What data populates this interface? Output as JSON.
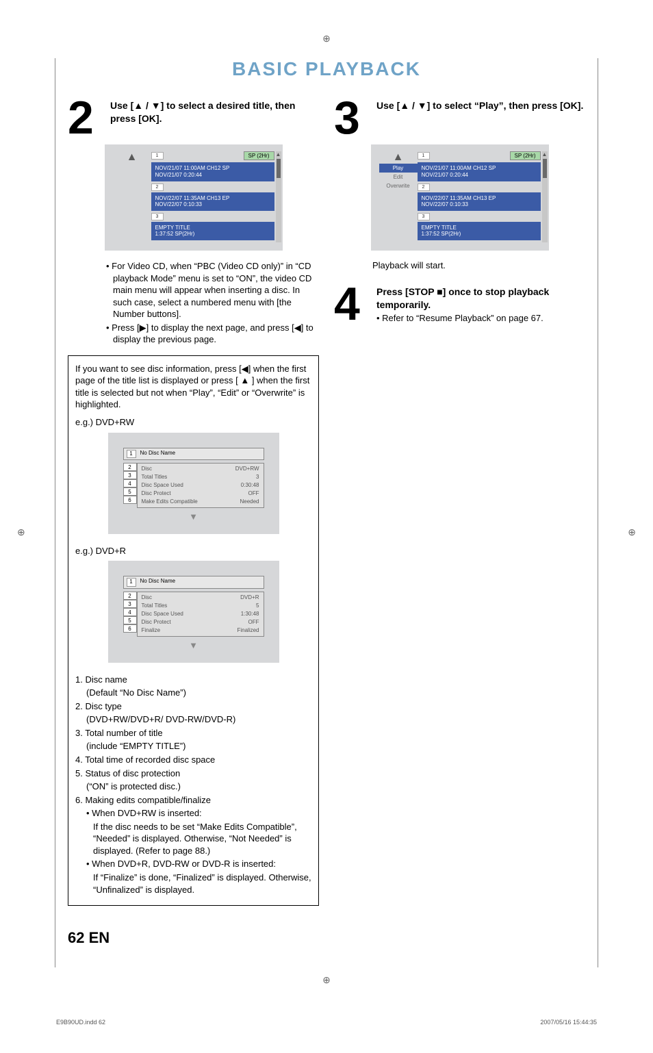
{
  "section_title": "BASIC PLAYBACK",
  "step2": {
    "head": "Use [▲ / ▼] to select a desired title, then press [OK].",
    "panel": {
      "sp_badge": "1",
      "sp_right": "SP (2Hr)",
      "rows": [
        {
          "line1": "NOV/21/07  11:00AM CH12  SP",
          "line2": "NOV/21/07    0:20:44"
        },
        {
          "line1": "NOV/22/07  11:35AM CH13  EP",
          "line2": "NOV/22/07    0:10:33"
        },
        {
          "line1": "EMPTY TITLE",
          "line2": "1:37:52   SP(2Hr)"
        }
      ],
      "row_badges": [
        "2",
        "3"
      ]
    },
    "bullets": [
      "• For Video CD, when “PBC (Video CD only)” in “CD playback Mode” menu is set to “ON”, the video CD main menu will appear when inserting a disc. In such case, select a numbered menu with [the Number buttons].",
      "• Press [▶] to display the next page, and press [◀] to display the previous page."
    ]
  },
  "infobox": {
    "intro": "If you want to see disc information, press [◀] when the first page of the title list is displayed or press [ ▲ ] when the first title is selected but not when “Play”, “Edit” or “Overwrite” is highlighted.",
    "eg1_label": "e.g.) DVD+RW",
    "eg2_label": "e.g.) DVD+R",
    "disc1": {
      "name_num": "1",
      "name": "No Disc Name",
      "rows": [
        {
          "n": "2",
          "k": "Disc",
          "v": "DVD+RW"
        },
        {
          "n": "3",
          "k": "Total Titles",
          "v": "3"
        },
        {
          "n": "4",
          "k": "Disc Space Used",
          "v": "0:30:48"
        },
        {
          "n": "5",
          "k": "Disc Protect",
          "v": "OFF"
        },
        {
          "n": "6",
          "k": "Make Edits Compatible",
          "v": "Needed"
        }
      ]
    },
    "disc2": {
      "name_num": "1",
      "name": "No Disc Name",
      "rows": [
        {
          "n": "2",
          "k": "Disc",
          "v": "DVD+R"
        },
        {
          "n": "3",
          "k": "Total Titles",
          "v": "5"
        },
        {
          "n": "4",
          "k": "Disc Space Used",
          "v": "1:30:48"
        },
        {
          "n": "5",
          "k": "Disc Protect",
          "v": "OFF"
        },
        {
          "n": "6",
          "k": "Finalize",
          "v": "Finalized"
        }
      ]
    },
    "list": {
      "i1a": "1. Disc name",
      "i1b": "(Default “No Disc Name”)",
      "i2a": "2. Disc type",
      "i2b": "(DVD+RW/DVD+R/ DVD-RW/DVD-R)",
      "i3a": "3. Total number of title",
      "i3b": "(include “EMPTY TITLE”)",
      "i4": "4. Total time of recorded disc space",
      "i5a": "5. Status of disc protection",
      "i5b": "(“ON” is protected disc.)",
      "i6": "6. Making edits compatible/finalize",
      "i6a": "• When DVD+RW is inserted:",
      "i6a2": "If the disc needs to be set “Make Edits Compatible”, “Needed” is displayed. Otherwise, “Not Needed” is displayed. (Refer to page 88.)",
      "i6b": "• When DVD+R, DVD-RW or DVD-R is inserted:",
      "i6b2": "If “Finalize” is done, “Finalized”  is displayed. Otherwise, “Unfinalized” is displayed."
    }
  },
  "step3": {
    "head": "Use [▲ / ▼] to select “Play”, then press [OK].",
    "panel": {
      "side": [
        "Play",
        "Edit",
        "Overwrite"
      ],
      "sp_badge": "1",
      "sp_right": "SP (2Hr)",
      "rows": [
        {
          "line1": "NOV/21/07  11:00AM CH12  SP",
          "line2": "NOV/21/07    0:20:44"
        },
        {
          "line1": "NOV/22/07  11:35AM CH13  EP",
          "line2": "NOV/22/07    0:10:33"
        },
        {
          "line1": "EMPTY TITLE",
          "line2": "1:37:52   SP(2Hr)"
        }
      ],
      "row_badges": [
        "2",
        "3"
      ]
    },
    "after": "Playback will start."
  },
  "step4": {
    "head": "Press [STOP ■] once to stop playback temporarily.",
    "bullet": "• Refer to “Resume Playback” on page 67."
  },
  "footer_page": "62    EN",
  "footer_left": "E9B90UD.indd   62",
  "footer_right": "2007/05/16   15:44:35"
}
